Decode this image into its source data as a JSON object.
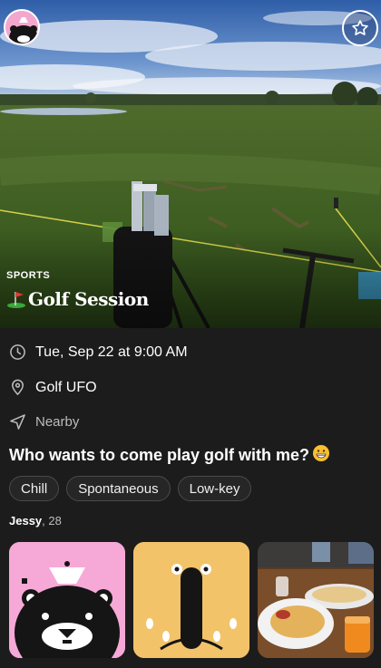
{
  "event": {
    "category": "SPORTS",
    "title_emoji_icon": "golf-flag-icon",
    "title": "Golf Session",
    "datetime": "Tue, Sep 22 at 9:00 AM",
    "location": "Golf UFO",
    "distance": "Nearby",
    "description": "Who wants to come play golf with me?",
    "description_emoji_icon": "grinning-face-icon",
    "tags": [
      "Chill",
      "Spontaneous",
      "Low-key"
    ]
  },
  "host": {
    "name": "Jessy",
    "age_text": ", 28"
  },
  "photos": [
    {
      "icon": "bear-avatar-icon",
      "bg": "#f6a9d6"
    },
    {
      "icon": "penguin-avatar-icon",
      "bg": "#f3c36a"
    },
    {
      "icon": "food-photo-icon",
      "bg": "#6b4a2f"
    }
  ],
  "colors": {
    "background": "#1c1c1c",
    "text": "#ffffff",
    "muted": "#bdbdbd",
    "tag_border": "#4a4a4a"
  }
}
